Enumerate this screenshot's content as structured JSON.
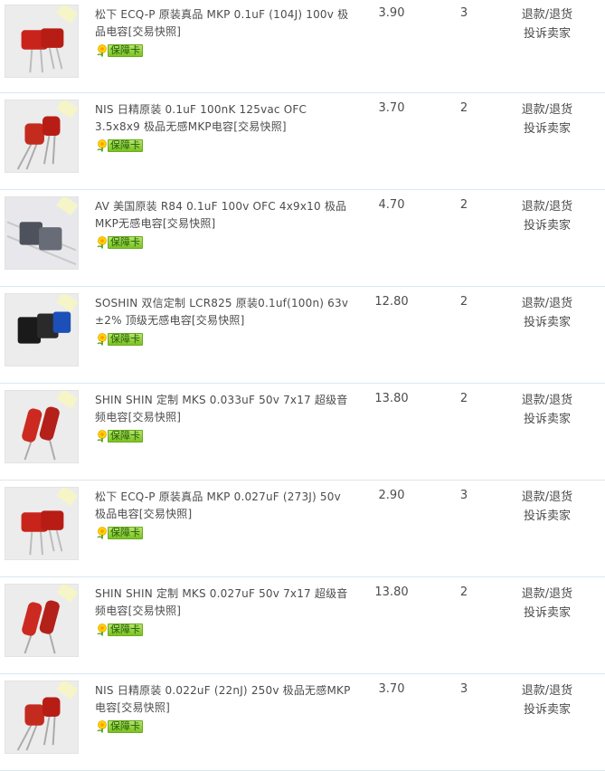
{
  "badge_label": "保障卡",
  "orders": [
    {
      "title": "松下 ECQ-P 原装真品 MKP 0.1uF (104J) 100v 极品电容[交易快照]",
      "price": "3.90",
      "quantity": "3",
      "refund_label": "退款/退货",
      "complain_label": "投诉卖家",
      "image": "red-box-film-capacitor-icon"
    },
    {
      "title": "NIS 日精原装 0.1uF 100nK 125vac OFC 3.5x8x9 极品无感MKP电容[交易快照]",
      "price": "3.70",
      "quantity": "2",
      "refund_label": "退款/退货",
      "complain_label": "投诉卖家",
      "image": "red-radial-capacitor-icon"
    },
    {
      "title": "AV 美国原装 R84 0.1uF 100v OFC 4x9x10 极品MKP无感电容[交易快照]",
      "price": "4.70",
      "quantity": "2",
      "refund_label": "退款/退货",
      "complain_label": "投诉卖家",
      "image": "gray-box-capacitor-icon"
    },
    {
      "title": "SOSHIN 双信定制 LCR825 原装0.1uf(100n) 63v ±2% 顶级无感电容[交易快照]",
      "price": "12.80",
      "quantity": "2",
      "refund_label": "退款/退货",
      "complain_label": "投诉卖家",
      "image": "black-blue-box-capacitor-icon"
    },
    {
      "title": "SHIN SHIN 定制 MKS 0.033uF 50v 7x17 超级音频电容[交易快照]",
      "price": "13.80",
      "quantity": "2",
      "refund_label": "退款/退货",
      "complain_label": "投诉卖家",
      "image": "red-cylinder-capacitor-icon"
    },
    {
      "title": "松下 ECQ-P 原装真品 MKP 0.027uF (273J) 50v 极品电容[交易快照]",
      "price": "2.90",
      "quantity": "3",
      "refund_label": "退款/退货",
      "complain_label": "投诉卖家",
      "image": "red-box-film-capacitor-icon"
    },
    {
      "title": "SHIN SHIN 定制 MKS 0.027uF 50v 7x17 超级音频电容[交易快照]",
      "price": "13.80",
      "quantity": "2",
      "refund_label": "退款/退货",
      "complain_label": "投诉卖家",
      "image": "red-cylinder-capacitor-icon"
    },
    {
      "title": "NIS 日精原装 0.022uF (22nJ) 250v 极品无感MKP电容[交易快照]",
      "price": "3.70",
      "quantity": "3",
      "refund_label": "退款/退货",
      "complain_label": "投诉卖家",
      "image": "red-radial-capacitor-icon"
    }
  ]
}
